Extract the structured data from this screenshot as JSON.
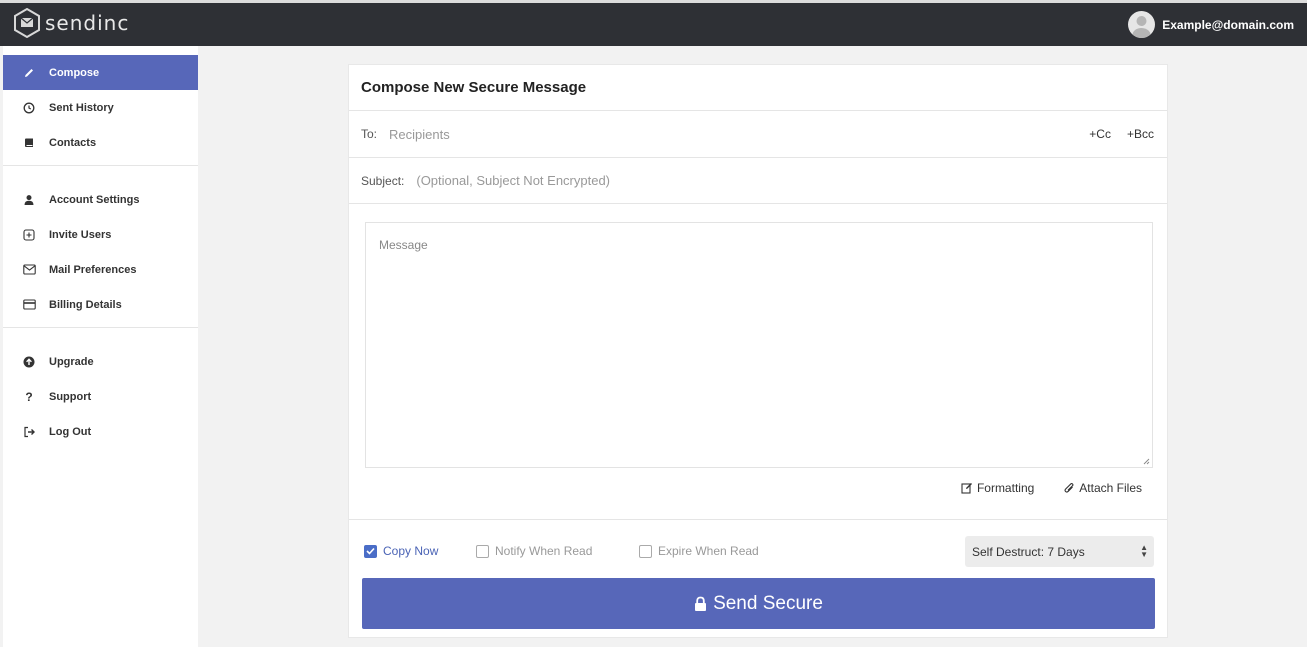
{
  "app": {
    "logo_text": "sendinc",
    "user_email": "Example@domain.com"
  },
  "sidebar": {
    "groups": [
      [
        {
          "label": "Compose",
          "icon": "pencil-icon",
          "active": true
        },
        {
          "label": "Sent History",
          "icon": "clock-icon"
        },
        {
          "label": "Contacts",
          "icon": "address-book-icon"
        }
      ],
      [
        {
          "label": "Account Settings",
          "icon": "user-icon"
        },
        {
          "label": "Invite Users",
          "icon": "plus-square-icon"
        },
        {
          "label": "Mail Preferences",
          "icon": "envelope-icon"
        },
        {
          "label": "Billing Details",
          "icon": "credit-card-icon"
        }
      ],
      [
        {
          "label": "Upgrade",
          "icon": "arrow-up-circle-icon"
        },
        {
          "label": "Support",
          "icon": "question-icon"
        },
        {
          "label": "Log Out",
          "icon": "sign-out-icon"
        }
      ]
    ]
  },
  "compose": {
    "title": "Compose New Secure Message",
    "to_label": "To:",
    "to_placeholder": "Recipients",
    "cc_label": "+Cc",
    "bcc_label": "+Bcc",
    "subject_label": "Subject:",
    "subject_placeholder": "(Optional, Subject Not Encrypted)",
    "message_placeholder": "Message",
    "formatting_label": "Formatting",
    "attach_label": "Attach Files",
    "options": {
      "copy_now": {
        "label": "Copy Now",
        "checked": true
      },
      "notify_when_read": {
        "label": "Notify When Read",
        "checked": false
      },
      "expire_when_read": {
        "label": "Expire When Read",
        "checked": false
      }
    },
    "self_destruct": "Self Destruct: 7 Days",
    "send_label": "Send Secure"
  },
  "colors": {
    "accent": "#5767b9",
    "topbar": "#2e3035",
    "checkbox": "#4a6dc7"
  }
}
